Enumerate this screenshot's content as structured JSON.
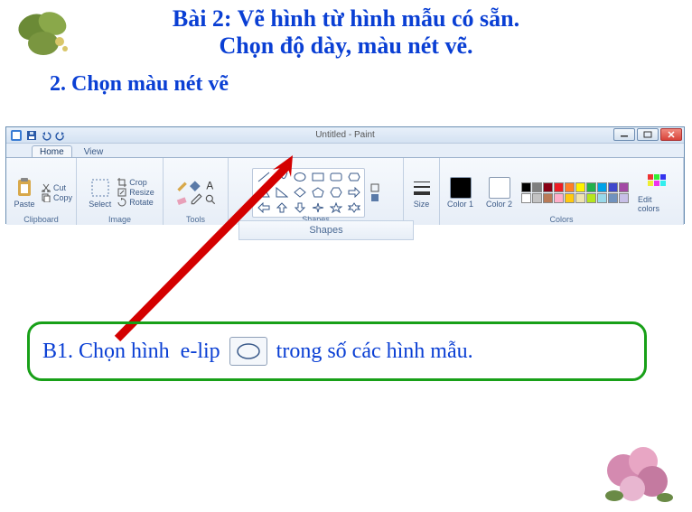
{
  "title": {
    "line1": "Bài 2: Vẽ hình từ hình mẫu có sẵn.",
    "line2": "Chọn độ dày, màu nét vẽ."
  },
  "subtitle": "2. Chọn màu nét vẽ",
  "paint": {
    "app_title": "Untitled - Paint",
    "tabs": {
      "home": "Home",
      "view": "View"
    },
    "groups": {
      "clipboard": {
        "label": "Clipboard",
        "paste": "Paste",
        "cut": "Cut",
        "copy": "Copy"
      },
      "image": {
        "label": "Image",
        "select": "Select",
        "crop": "Crop",
        "resize": "Resize",
        "rotate": "Rotate"
      },
      "tools": {
        "label": "Tools"
      },
      "shapes": {
        "label": "Shapes"
      },
      "size": {
        "label": "Size"
      },
      "colors": {
        "label": "Colors",
        "color1": "Color 1",
        "color2": "Color 2",
        "edit": "Edit colors"
      }
    }
  },
  "shapes_popup_label": "Shapes",
  "callout": {
    "before": "B1. Chọn hình  e-lip ",
    "after": " trong số các hình mẫu."
  },
  "palette": {
    "row1": [
      "#000000",
      "#7f7f7f",
      "#880015",
      "#ed1c24",
      "#ff7f27",
      "#fff200",
      "#22b14c",
      "#00a2e8",
      "#3f48cc",
      "#a349a4"
    ],
    "row2": [
      "#ffffff",
      "#c3c3c3",
      "#b97a57",
      "#ffaec9",
      "#ffc90e",
      "#efe4b0",
      "#b5e61d",
      "#99d9ea",
      "#7092be",
      "#c8bfe7"
    ]
  }
}
